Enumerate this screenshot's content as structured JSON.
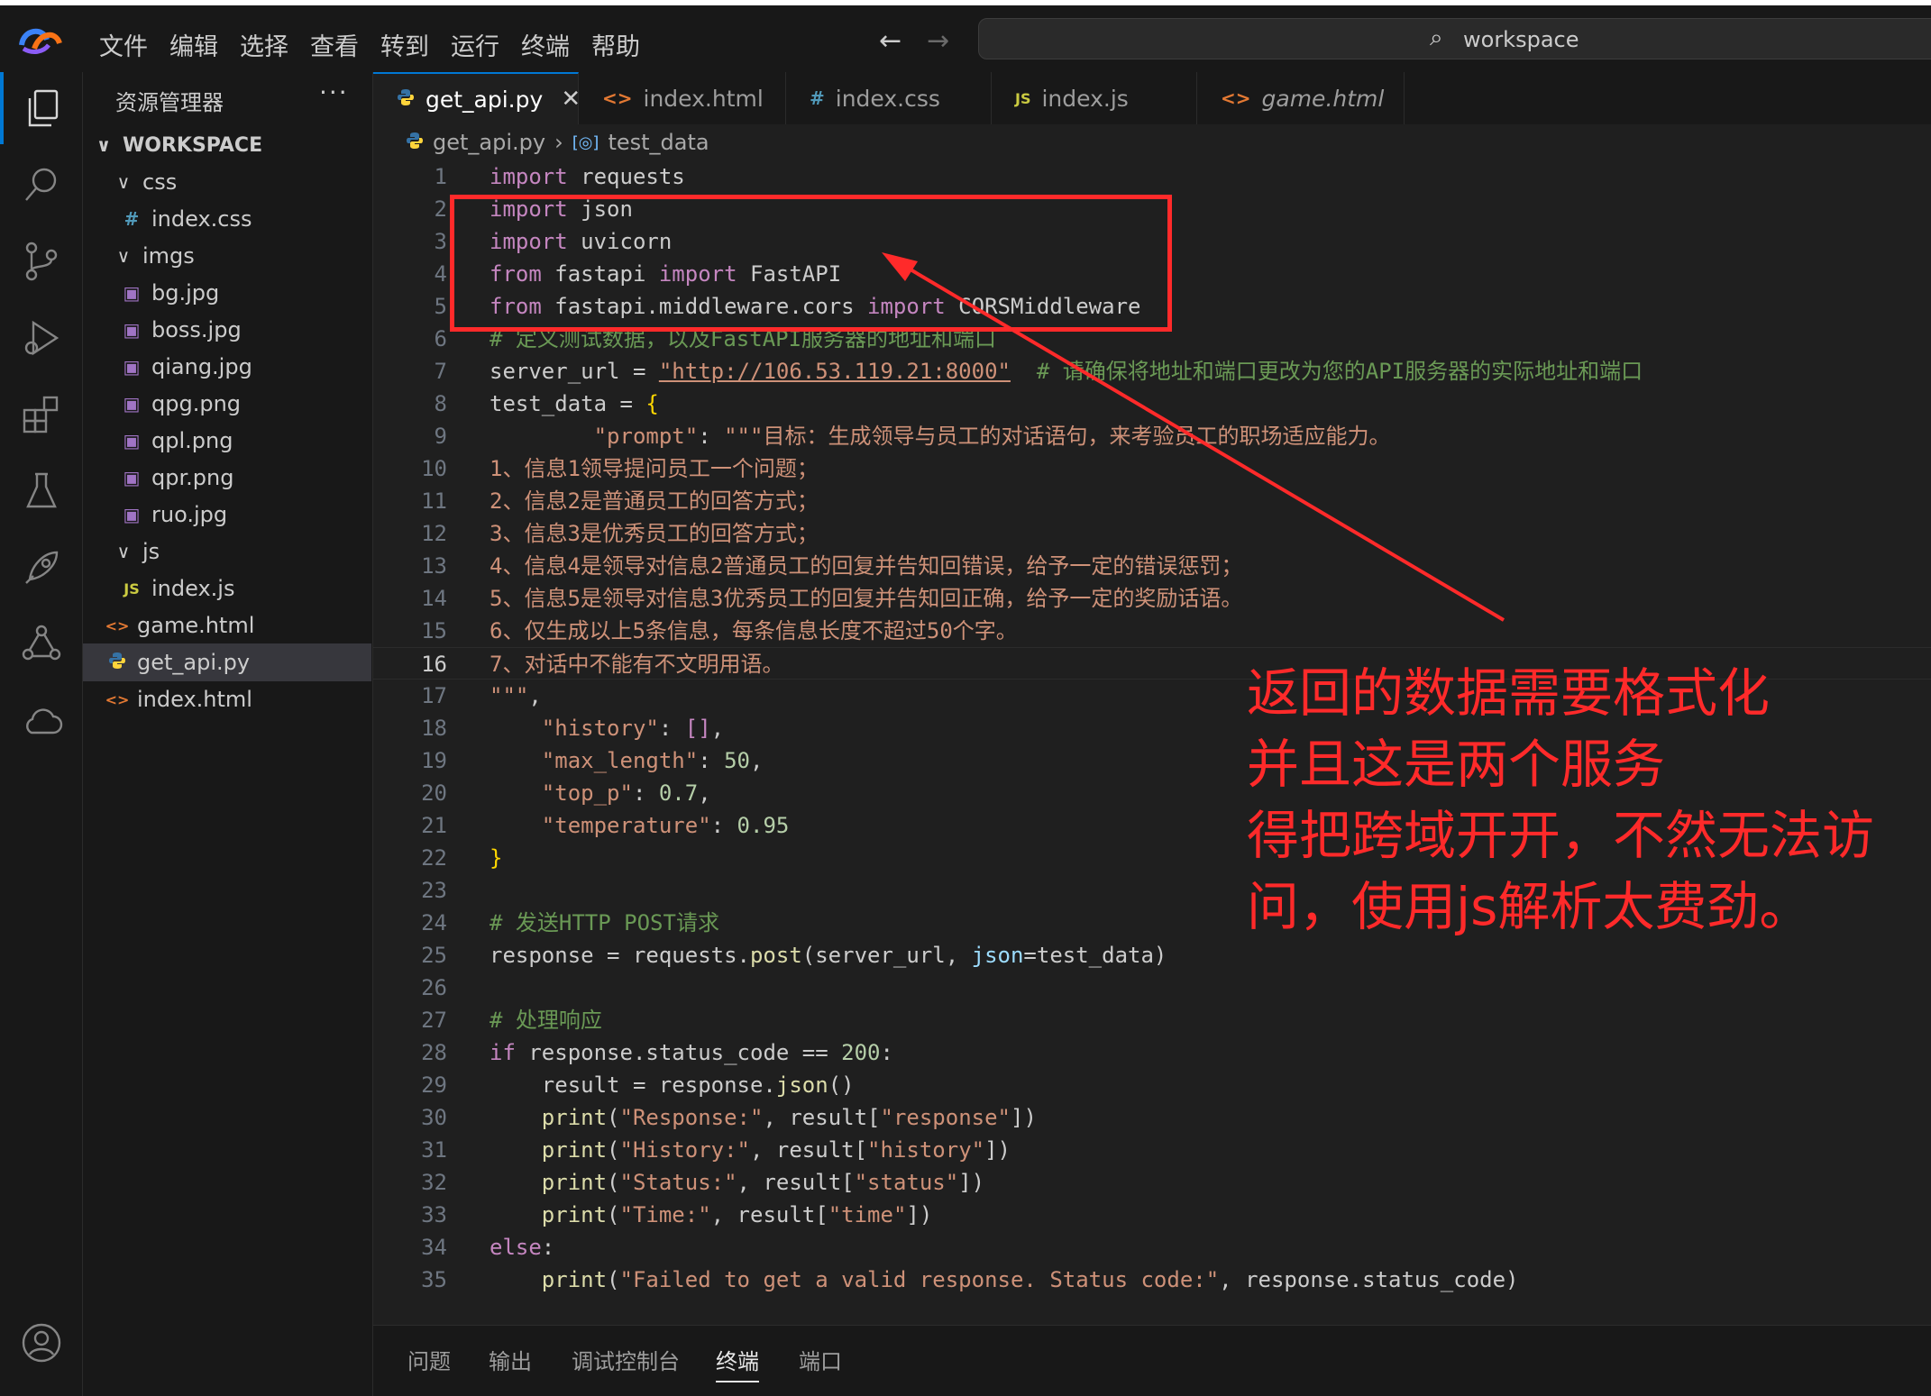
{
  "menu": [
    "文件",
    "编辑",
    "选择",
    "查看",
    "转到",
    "运行",
    "终端",
    "帮助"
  ],
  "search": {
    "text": "workspace"
  },
  "sidebar": {
    "title": "资源管理器",
    "more": "···",
    "workspace": "WORKSPACE",
    "items": [
      {
        "label": "css",
        "type": "folder",
        "depth": 1,
        "icon": "chevron-down-icon"
      },
      {
        "label": "index.css",
        "type": "css",
        "depth": 2,
        "icon_text": "#"
      },
      {
        "label": "imgs",
        "type": "folder",
        "depth": 1,
        "icon": "chevron-down-icon"
      },
      {
        "label": "bg.jpg",
        "type": "image",
        "depth": 2
      },
      {
        "label": "boss.jpg",
        "type": "image",
        "depth": 2
      },
      {
        "label": "qiang.jpg",
        "type": "image",
        "depth": 2
      },
      {
        "label": "qpg.png",
        "type": "image",
        "depth": 2
      },
      {
        "label": "qpl.png",
        "type": "image",
        "depth": 2
      },
      {
        "label": "qpr.png",
        "type": "image",
        "depth": 2
      },
      {
        "label": "ruo.jpg",
        "type": "image",
        "depth": 2
      },
      {
        "label": "js",
        "type": "folder",
        "depth": 1,
        "icon": "chevron-down-icon"
      },
      {
        "label": "index.js",
        "type": "js",
        "depth": 2,
        "icon_text": "JS"
      },
      {
        "label": "game.html",
        "type": "html",
        "depth": 1,
        "icon_text": "<>"
      },
      {
        "label": "get_api.py",
        "type": "python",
        "depth": 1,
        "selected": true
      },
      {
        "label": "index.html",
        "type": "html",
        "depth": 1,
        "icon_text": "<>"
      }
    ]
  },
  "tabs": [
    {
      "label": "get_api.py",
      "icon_text": "",
      "active": true,
      "close": "✕"
    },
    {
      "label": "index.html",
      "icon_text": "<>"
    },
    {
      "label": "index.css",
      "icon_text": "#"
    },
    {
      "label": "index.js",
      "icon_text": "JS"
    },
    {
      "label": "game.html",
      "icon_text": "<>",
      "italic": true
    }
  ],
  "breadcrumb": {
    "file": "get_api.py",
    "symbol": "test_data"
  },
  "code": {
    "current_line": 16,
    "line_numbers": [
      "1",
      "2",
      "3",
      "4",
      "5",
      "6",
      "7",
      "8",
      "9",
      "10",
      "11",
      "12",
      "13",
      "14",
      "15",
      "16",
      "17",
      "18",
      "19",
      "20",
      "21",
      "22",
      "23",
      "24",
      "25",
      "26",
      "27",
      "28",
      "29",
      "30",
      "31",
      "32",
      "33",
      "34",
      "35"
    ],
    "comment_6": "# 定义测试数据，以及FastAPI服务器的地址和端口",
    "server_url": "\"http://106.53.119.21:8000\"",
    "comment_7": "# 请确保将地址和端口更改为您的API服务器的实际地址和端口",
    "prompt_text": "\"\"\"目标：生成领导与员工的对话语句，来考验员工的职场适应能力。",
    "line_10": "1、信息1领导提问员工一个问题；",
    "line_11": "2、信息2是普通员工的回答方式；",
    "line_12": "3、信息3是优秀员工的回答方式；",
    "line_13": "4、信息4是领导对信息2普通员工的回复并告知回错误，给予一定的错误惩罚；",
    "line_14": "5、信息5是领导对信息3优秀员工的回复并告知回正确，给予一定的奖励话语。",
    "line_15": "6、仅生成以上5条信息，每条信息长度不超过50个字。",
    "line_16": "7、对话中不能有不文明用语。",
    "comment_24": "# 发送HTTP POST请求",
    "comment_27": "# 处理响应",
    "failed_msg": "\"Failed to get a valid response. Status code:\""
  },
  "annotation": [
    "返回的数据需要格式化",
    "并且这是两个服务",
    "得把跨域开开，不然无法访",
    "问，使用js解析太费劲。"
  ],
  "panel_tabs": [
    "问题",
    "输出",
    "调试控制台",
    "终端",
    "端口"
  ],
  "colors": {
    "annotation_red": "#ff2a2a",
    "accent": "#0078d4"
  }
}
